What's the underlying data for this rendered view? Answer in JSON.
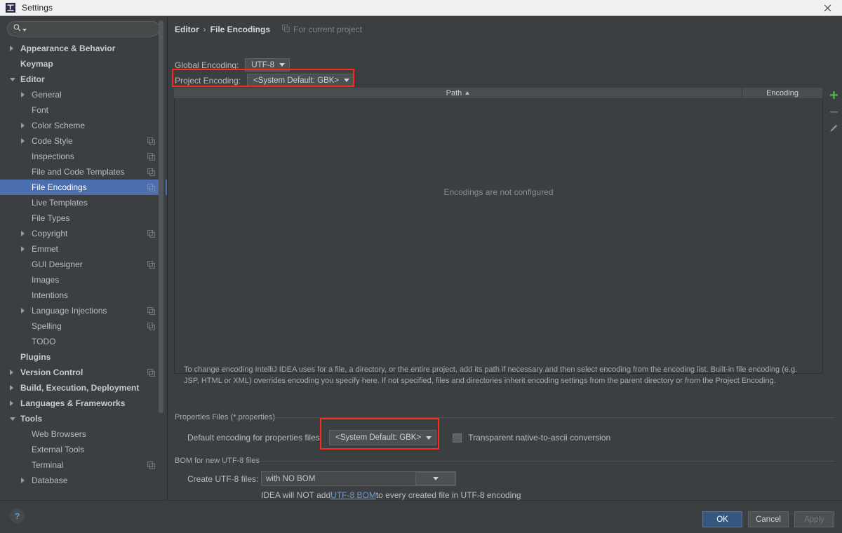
{
  "window": {
    "title": "Settings",
    "app_icon": "intellij-idea-icon",
    "close_icon": "close-icon"
  },
  "sidebar": {
    "search": {
      "placeholder": "",
      "value": "",
      "icon": "search-icon",
      "caret_icon": "chevron-down-icon"
    },
    "items": [
      {
        "label": "Appearance & Behavior",
        "indent": 0,
        "arrow": "collapsed",
        "bold": true,
        "badge": false
      },
      {
        "label": "Keymap",
        "indent": 0,
        "arrow": "none",
        "bold": true,
        "badge": false
      },
      {
        "label": "Editor",
        "indent": 0,
        "arrow": "expanded",
        "bold": true,
        "badge": false
      },
      {
        "label": "General",
        "indent": 1,
        "arrow": "collapsed",
        "bold": false,
        "badge": false
      },
      {
        "label": "Font",
        "indent": 1,
        "arrow": "none",
        "bold": false,
        "badge": false
      },
      {
        "label": "Color Scheme",
        "indent": 1,
        "arrow": "collapsed",
        "bold": false,
        "badge": false
      },
      {
        "label": "Code Style",
        "indent": 1,
        "arrow": "collapsed",
        "bold": false,
        "badge": true
      },
      {
        "label": "Inspections",
        "indent": 1,
        "arrow": "none",
        "bold": false,
        "badge": true
      },
      {
        "label": "File and Code Templates",
        "indent": 1,
        "arrow": "none",
        "bold": false,
        "badge": true
      },
      {
        "label": "File Encodings",
        "indent": 1,
        "arrow": "none",
        "bold": false,
        "badge": true,
        "selected": true
      },
      {
        "label": "Live Templates",
        "indent": 1,
        "arrow": "none",
        "bold": false,
        "badge": false
      },
      {
        "label": "File Types",
        "indent": 1,
        "arrow": "none",
        "bold": false,
        "badge": false
      },
      {
        "label": "Copyright",
        "indent": 1,
        "arrow": "collapsed",
        "bold": false,
        "badge": true
      },
      {
        "label": "Emmet",
        "indent": 1,
        "arrow": "collapsed",
        "bold": false,
        "badge": false
      },
      {
        "label": "GUI Designer",
        "indent": 1,
        "arrow": "none",
        "bold": false,
        "badge": true
      },
      {
        "label": "Images",
        "indent": 1,
        "arrow": "none",
        "bold": false,
        "badge": false
      },
      {
        "label": "Intentions",
        "indent": 1,
        "arrow": "none",
        "bold": false,
        "badge": false
      },
      {
        "label": "Language Injections",
        "indent": 1,
        "arrow": "collapsed",
        "bold": false,
        "badge": true
      },
      {
        "label": "Spelling",
        "indent": 1,
        "arrow": "none",
        "bold": false,
        "badge": true
      },
      {
        "label": "TODO",
        "indent": 1,
        "arrow": "none",
        "bold": false,
        "badge": false
      },
      {
        "label": "Plugins",
        "indent": 0,
        "arrow": "none",
        "bold": true,
        "badge": false
      },
      {
        "label": "Version Control",
        "indent": 0,
        "arrow": "collapsed",
        "bold": true,
        "badge": true
      },
      {
        "label": "Build, Execution, Deployment",
        "indent": 0,
        "arrow": "collapsed",
        "bold": true,
        "badge": false
      },
      {
        "label": "Languages & Frameworks",
        "indent": 0,
        "arrow": "collapsed",
        "bold": true,
        "badge": false
      },
      {
        "label": "Tools",
        "indent": 0,
        "arrow": "expanded",
        "bold": true,
        "badge": false
      },
      {
        "label": "Web Browsers",
        "indent": 1,
        "arrow": "none",
        "bold": false,
        "badge": false
      },
      {
        "label": "External Tools",
        "indent": 1,
        "arrow": "none",
        "bold": false,
        "badge": false
      },
      {
        "label": "Terminal",
        "indent": 1,
        "arrow": "none",
        "bold": false,
        "badge": true
      },
      {
        "label": "Database",
        "indent": 1,
        "arrow": "collapsed",
        "bold": false,
        "badge": false
      }
    ]
  },
  "panel": {
    "breadcrumb": {
      "parent": "Editor",
      "separator": "›",
      "current": "File Encodings",
      "note": "For current project",
      "note_icon": "copy-badge-icon"
    },
    "global_encoding": {
      "label": "Global Encoding:",
      "value": "UTF-8"
    },
    "project_encoding": {
      "label": "Project Encoding:",
      "value": "<System Default: GBK>"
    },
    "table": {
      "columns": [
        "Path",
        "Encoding"
      ],
      "sort_column": "Path",
      "sort_direction": "ascending",
      "rows": [],
      "empty_message": "Encodings are not configured"
    },
    "table_tools": [
      {
        "name": "add-button",
        "icon": "plus-icon",
        "enabled": true
      },
      {
        "name": "remove-button",
        "icon": "minus-icon",
        "enabled": false
      },
      {
        "name": "edit-button",
        "icon": "pencil-icon",
        "enabled": false
      }
    ],
    "help_text": "To change encoding IntelliJ IDEA uses for a file, a directory, or the entire project, add its path if necessary and then select encoding from the encoding list. Built-in file encoding (e.g. JSP, HTML or XML) overrides encoding you specify here. If not specified, files and directories inherit encoding settings from the parent directory or from the Project Encoding.",
    "properties_section": {
      "title": "Properties Files (*.properties)",
      "default_encoding_label": "Default encoding for properties files:",
      "default_encoding_value": "<System Default: GBK>",
      "transparent_label": "Transparent native-to-ascii conversion",
      "transparent_checked": false
    },
    "bom_section": {
      "title": "BOM for new UTF-8 files",
      "create_label": "Create UTF-8 files:",
      "create_value": "with NO BOM",
      "note_prefix": "IDEA will NOT add ",
      "note_link": "UTF-8 BOM",
      "note_suffix": " to every created file in UTF-8 encoding"
    }
  },
  "footer": {
    "help_icon": "question-mark-icon",
    "ok_label": "OK",
    "cancel_label": "Cancel",
    "apply_label": "Apply",
    "apply_enabled": false
  },
  "colors": {
    "background": "#3c3f41",
    "selection": "#4b6eaf",
    "annotation": "#ff2a1a",
    "primary_button": "#365880",
    "link": "#6f9ad6",
    "add_icon": "#49b849"
  }
}
